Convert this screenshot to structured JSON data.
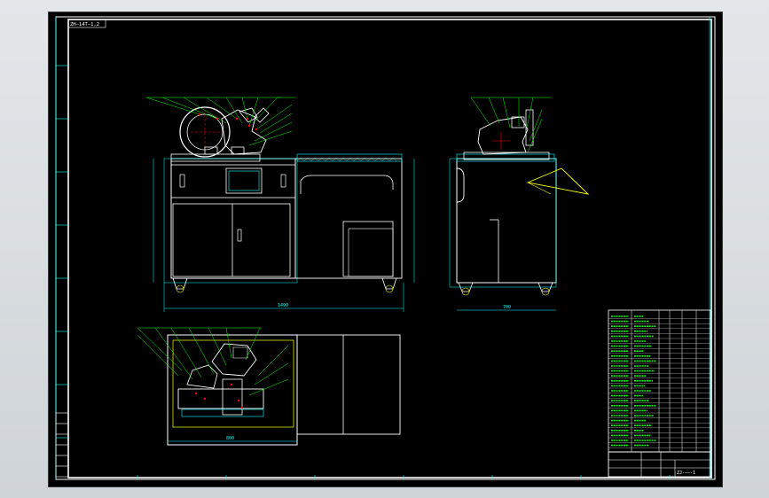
{
  "sheet": {
    "corner_label": "ZH—14T—1,2",
    "title_block_code": "ZJ‐——‐1",
    "colors": {
      "background": "#000000",
      "frame": "#ffffff",
      "green": "#00ff00",
      "cyan": "#00ffff",
      "yellow": "#ffff00",
      "red": "#ff0000",
      "white": "#ffffff"
    }
  },
  "views": {
    "front": "front-elevation",
    "side": "side-elevation",
    "top": "plan-view"
  }
}
